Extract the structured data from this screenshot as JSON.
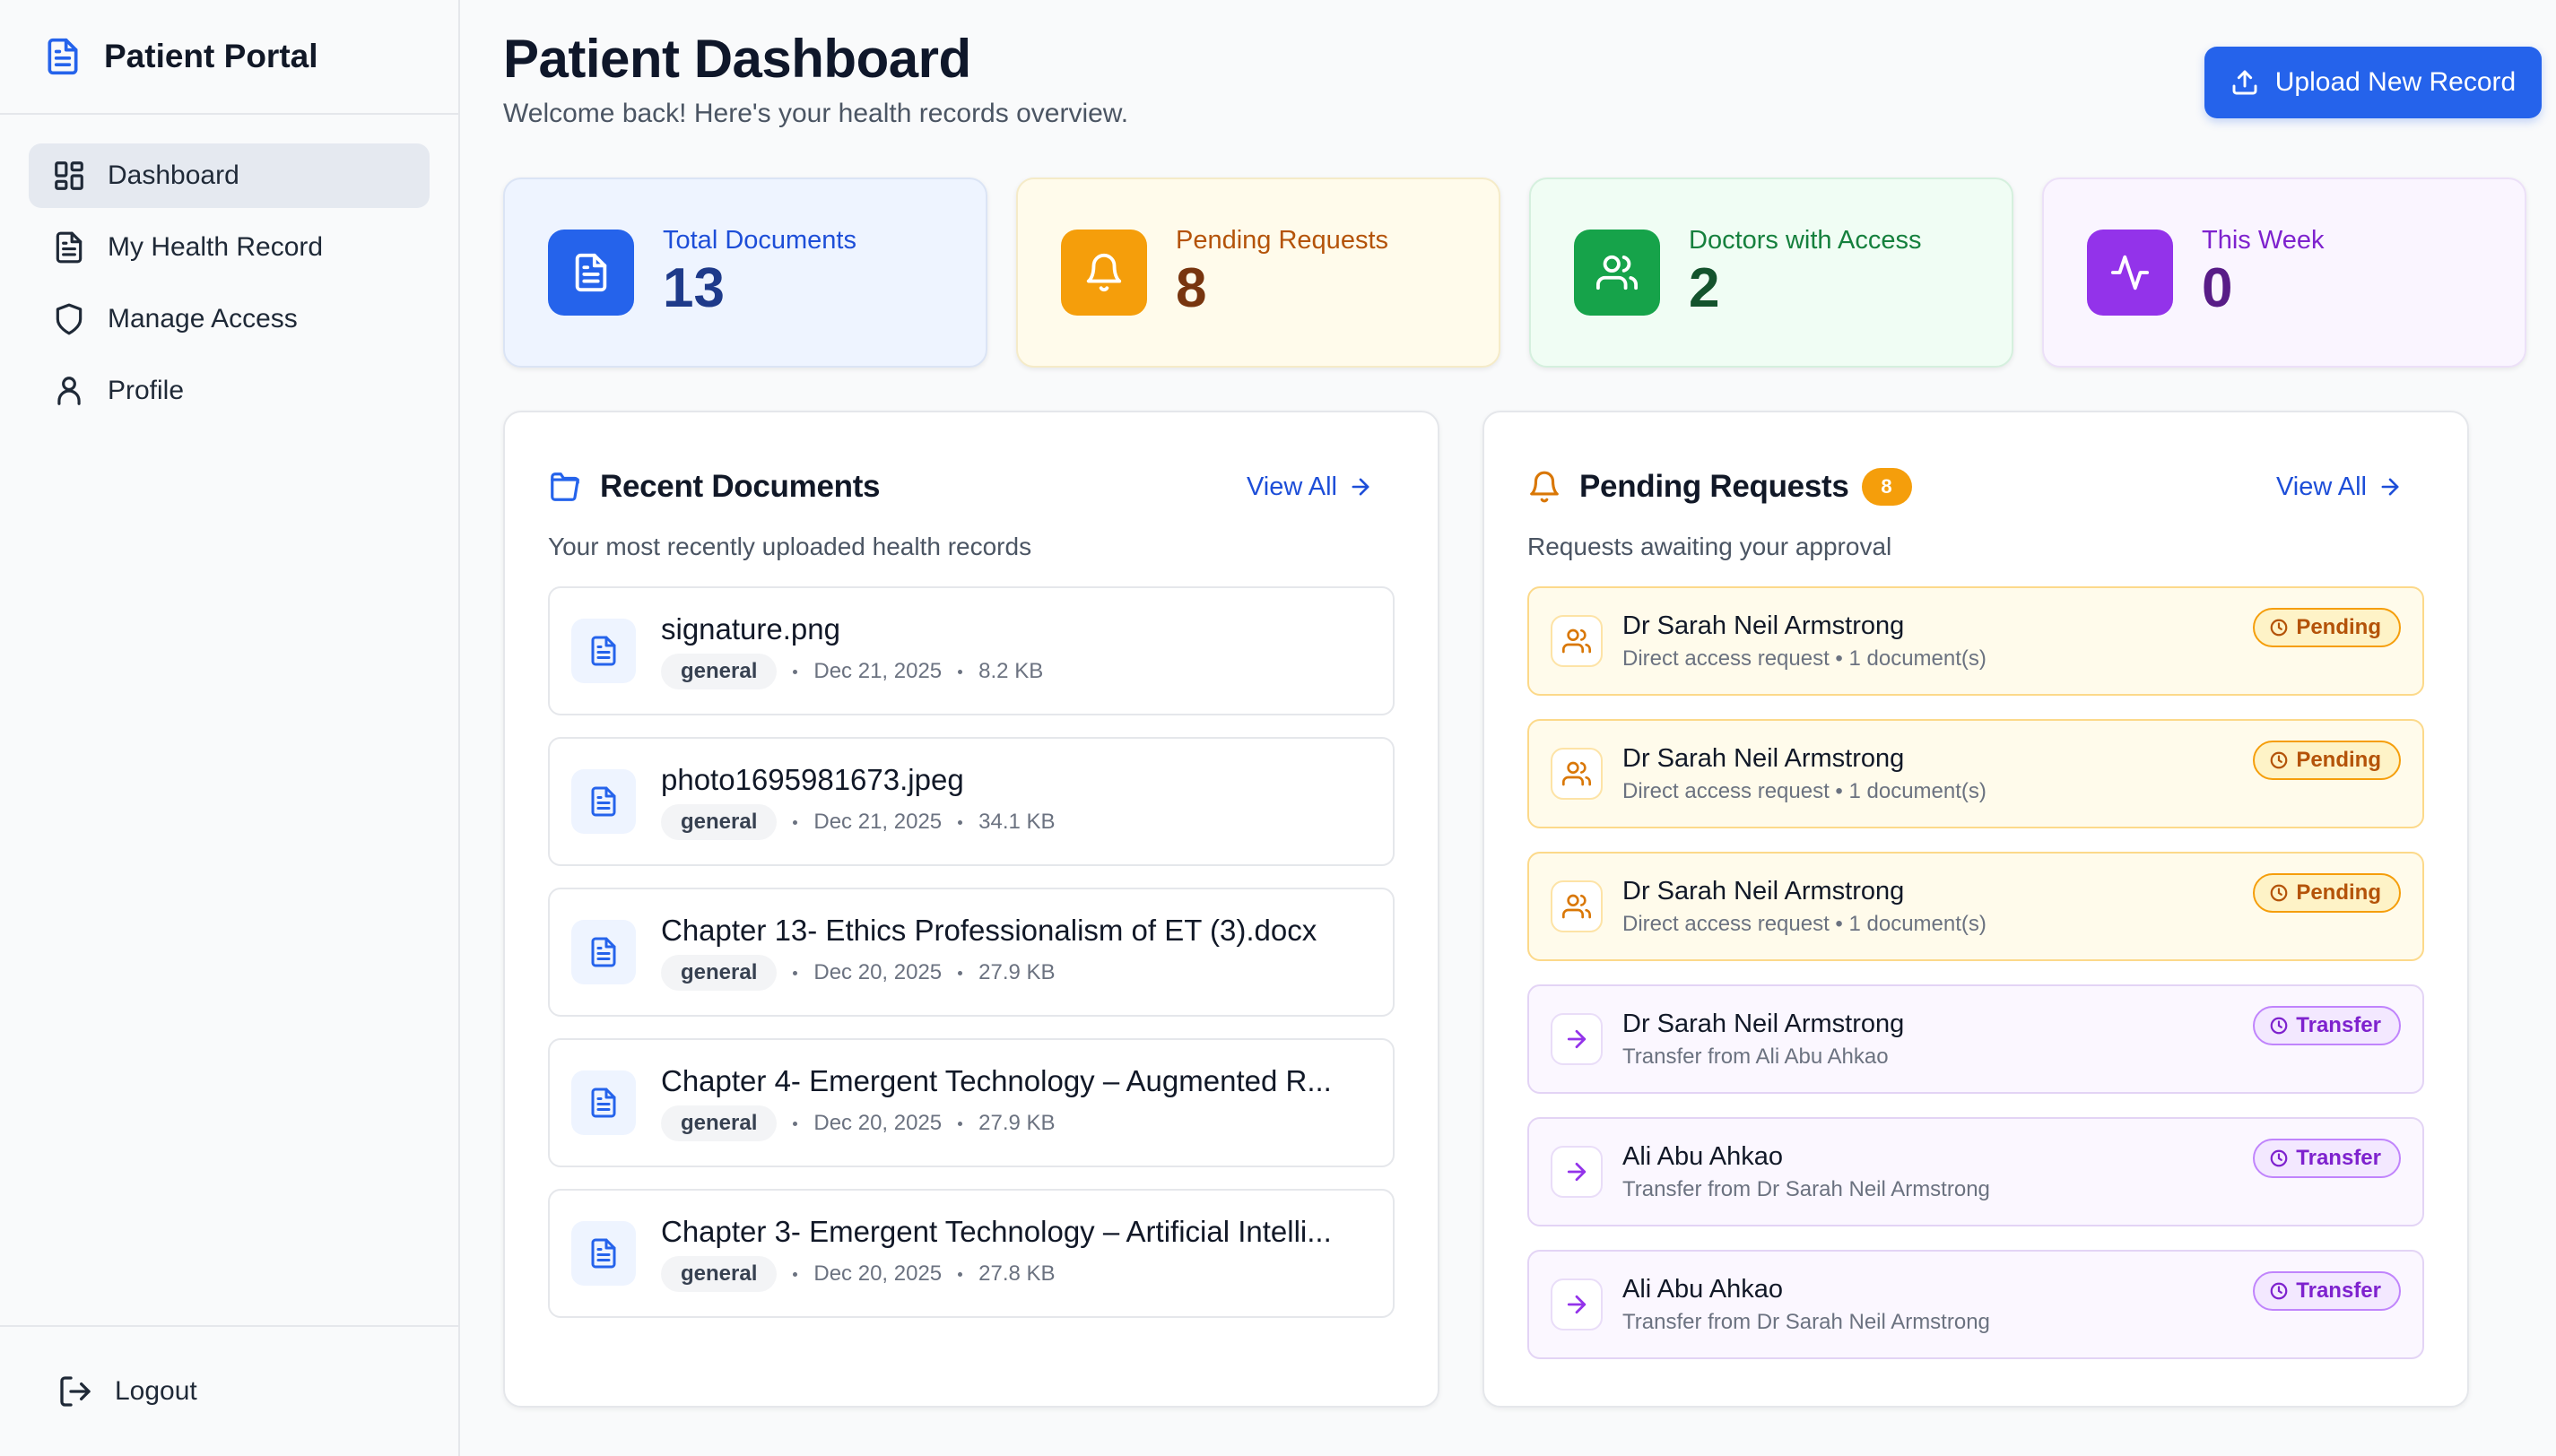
{
  "sidebar": {
    "brand": "Patient Portal",
    "items": [
      {
        "label": "Dashboard",
        "icon": "dashboard-icon",
        "active": true
      },
      {
        "label": "My Health Record",
        "icon": "document-icon"
      },
      {
        "label": "Manage Access",
        "icon": "shield-icon"
      },
      {
        "label": "Profile",
        "icon": "user-icon"
      }
    ],
    "logout": "Logout"
  },
  "header": {
    "title": "Patient Dashboard",
    "subtitle": "Welcome back! Here's your health records overview.",
    "upload_label": "Upload New Record"
  },
  "stats": [
    {
      "label": "Total Documents",
      "value": "13",
      "icon": "document-icon",
      "color": "#2563eb"
    },
    {
      "label": "Pending Requests",
      "value": "8",
      "icon": "bell-icon",
      "color": "#f59e0b"
    },
    {
      "label": "Doctors with Access",
      "value": "2",
      "icon": "users-icon",
      "color": "#16a34a"
    },
    {
      "label": "This Week",
      "value": "0",
      "icon": "activity-icon",
      "color": "#9333ea"
    }
  ],
  "recent_documents": {
    "title": "Recent Documents",
    "view_all": "View All",
    "subtitle": "Your most recently uploaded health records",
    "items": [
      {
        "name": "signature.png",
        "tag": "general",
        "date": "Dec 21, 2025",
        "size": "8.2 KB"
      },
      {
        "name": "photo1695981673.jpeg",
        "tag": "general",
        "date": "Dec 21, 2025",
        "size": "34.1 KB"
      },
      {
        "name": "Chapter 13- Ethics Professionalism of ET (3).docx",
        "tag": "general",
        "date": "Dec 20, 2025",
        "size": "27.9 KB"
      },
      {
        "name": "Chapter 4- Emergent Technology – Augmented R...",
        "tag": "general",
        "date": "Dec 20, 2025",
        "size": "27.9 KB"
      },
      {
        "name": "Chapter 3- Emergent Technology – Artificial Intelli...",
        "tag": "general",
        "date": "Dec 20, 2025",
        "size": "27.8 KB"
      }
    ]
  },
  "pending_requests": {
    "title": "Pending Requests",
    "count": "8",
    "view_all": "View All",
    "subtitle": "Requests awaiting your approval",
    "items": [
      {
        "name": "Dr Sarah Neil Armstrong",
        "desc": "Direct access request • 1 document(s)",
        "status": "Pending",
        "kind": "pending"
      },
      {
        "name": "Dr Sarah Neil Armstrong",
        "desc": "Direct access request • 1 document(s)",
        "status": "Pending",
        "kind": "pending"
      },
      {
        "name": "Dr Sarah Neil Armstrong",
        "desc": "Direct access request • 1 document(s)",
        "status": "Pending",
        "kind": "pending"
      },
      {
        "name": "Dr Sarah Neil Armstrong",
        "desc": "Transfer from Ali Abu Ahkao",
        "status": "Transfer",
        "kind": "transfer"
      },
      {
        "name": "Ali Abu Ahkao",
        "desc": "Transfer from Dr Sarah Neil Armstrong",
        "status": "Transfer",
        "kind": "transfer"
      },
      {
        "name": "Ali Abu Ahkao",
        "desc": "Transfer from Dr Sarah Neil Armstrong",
        "status": "Transfer",
        "kind": "transfer"
      }
    ]
  }
}
